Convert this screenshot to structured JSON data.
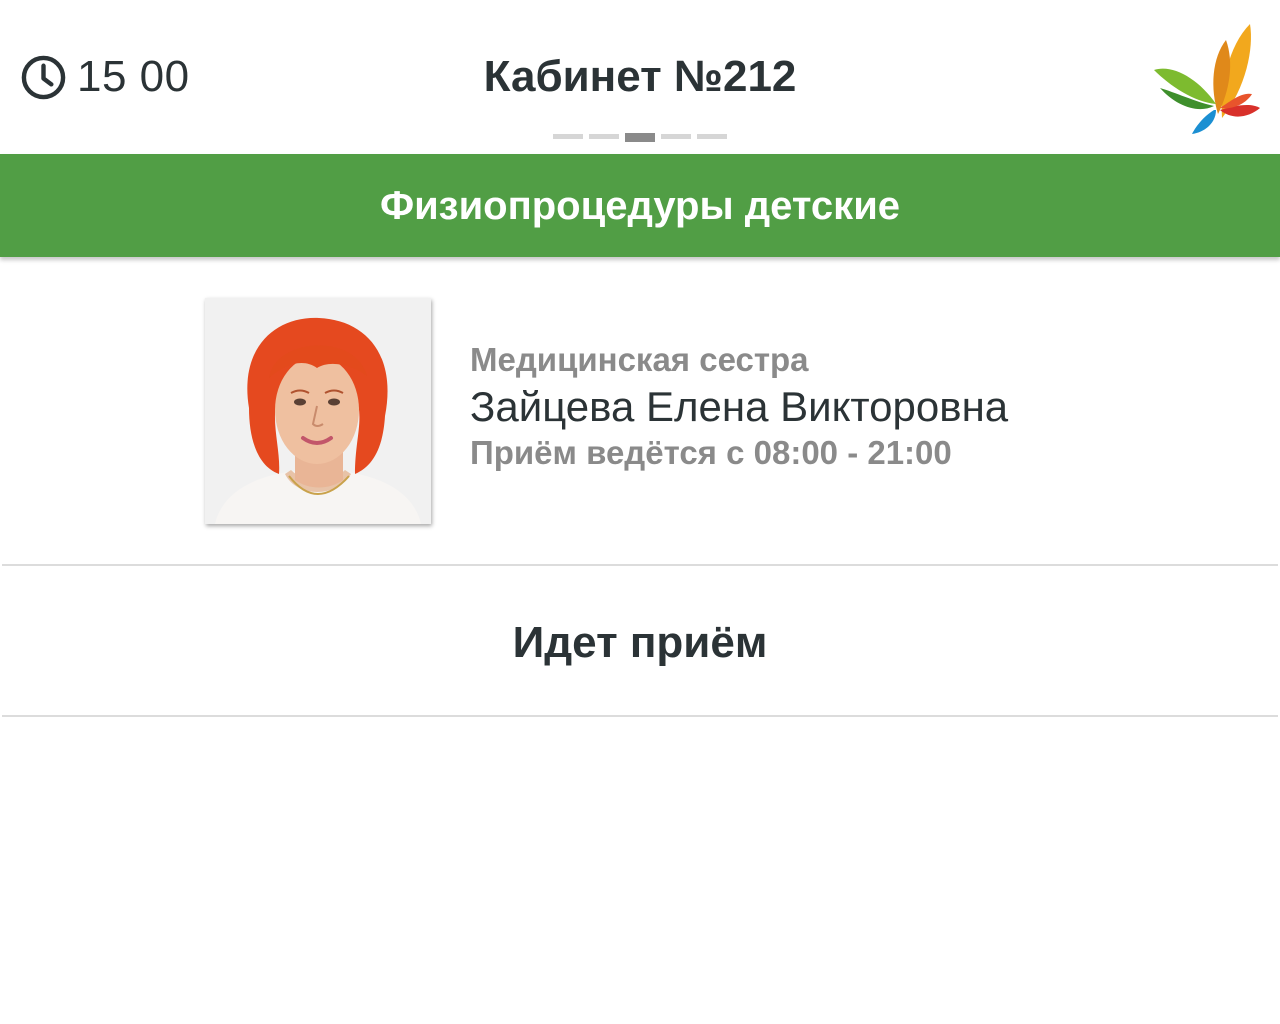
{
  "header": {
    "time": "15 00",
    "room_title": "Кабинет №212",
    "clock_icon": "clock-icon",
    "logo_icon": "butterfly-logo-icon",
    "slides": {
      "count": 5,
      "active_index": 2
    }
  },
  "banner": {
    "title": "Физиопроцедуры детские",
    "color": "#519e45"
  },
  "doctor": {
    "position": "Медицинская сестра",
    "name": "Зайцева Елена Викторовна",
    "hours": "Приём ведётся с 08:00 - 21:00",
    "photo_icon": "doctor-photo"
  },
  "status": {
    "text": "Идет приём"
  },
  "colors": {
    "text_dark": "#2b3336",
    "text_muted": "#8a8a8a",
    "divider": "#dcdcdc"
  }
}
